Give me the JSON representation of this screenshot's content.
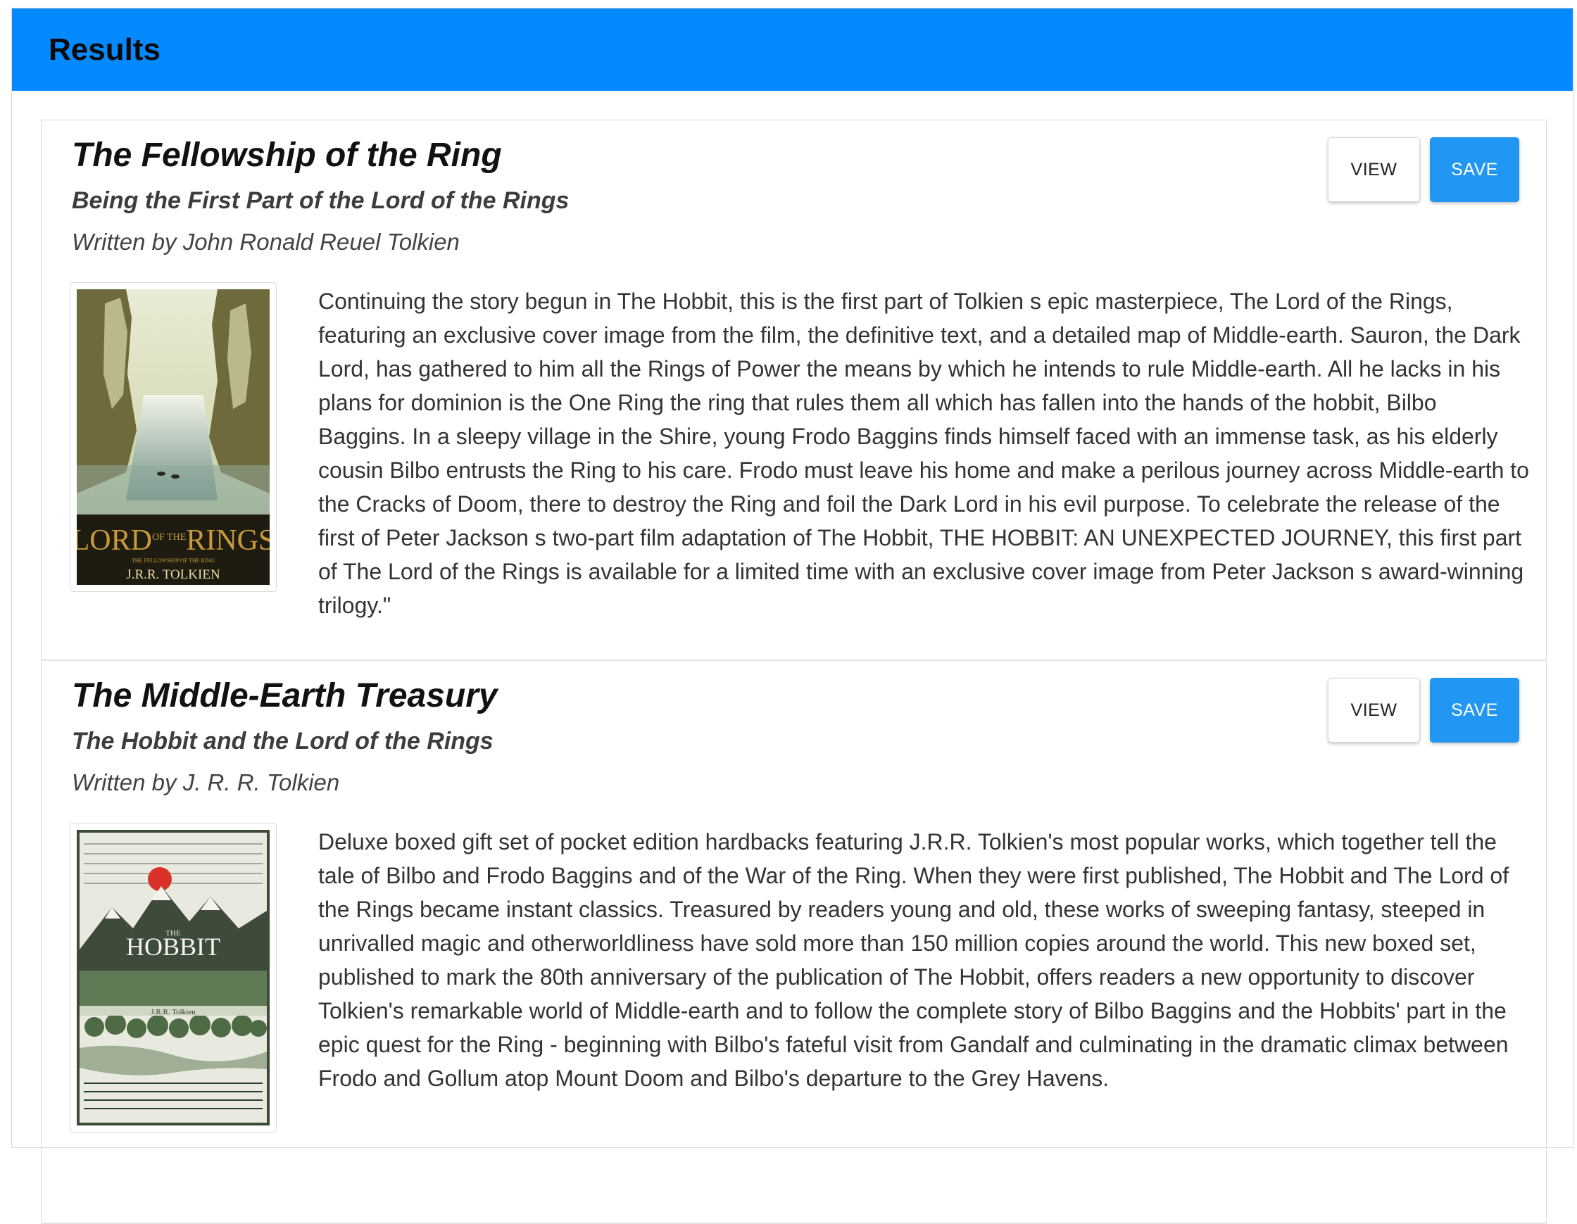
{
  "header": {
    "title": "Results"
  },
  "colors": {
    "header_bg": "#0589ff",
    "save_button": "#2196f3"
  },
  "results": [
    {
      "title": "The Fellowship of the Ring",
      "subtitle": "Being the First Part of the Lord of the Rings",
      "author": "Written by John Ronald Reuel Tolkien",
      "view_label": "VIEW",
      "save_label": "SAVE",
      "cover": {
        "line1": "LORD",
        "line1_small": "OF THE",
        "line1_end": "RINGS",
        "line2": "THE FELLOWSHIP OF THE RING",
        "line3": "J.R.R. TOLKIEN"
      },
      "description": "Continuing the story begun in The Hobbit, this is the first part of Tolkien s epic masterpiece, The Lord of the Rings, featuring an exclusive cover image from the film, the definitive text, and a detailed map of Middle-earth. Sauron, the Dark Lord, has gathered to him all the Rings of Power the means by which he intends to rule Middle-earth. All he lacks in his plans for dominion is the One Ring the ring that rules them all which has fallen into the hands of the hobbit, Bilbo Baggins. In a sleepy village in the Shire, young Frodo Baggins finds himself faced with an immense task, as his elderly cousin Bilbo entrusts the Ring to his care. Frodo must leave his home and make a perilous journey across Middle-earth to the Cracks of Doom, there to destroy the Ring and foil the Dark Lord in his evil purpose. To celebrate the release of the first of Peter Jackson s two-part film adaptation of The Hobbit, THE HOBBIT: AN UNEXPECTED JOURNEY, this first part of The Lord of the Rings is available for a limited time with an exclusive cover image from Peter Jackson s award-winning trilogy.\""
    },
    {
      "title": "The Middle-Earth Treasury",
      "subtitle": "The Hobbit and the Lord of the Rings",
      "author": "Written by J. R. R. Tolkien",
      "view_label": "VIEW",
      "save_label": "SAVE",
      "cover": {
        "line1": "THE",
        "line2": "HOBBIT",
        "line3": "J.R.R. Tolkien"
      },
      "description": "Deluxe boxed gift set of pocket edition hardbacks featuring J.R.R. Tolkien's most popular works, which together tell the tale of Bilbo and Frodo Baggins and of the War of the Ring. When they were first published, The Hobbit and The Lord of the Rings became instant classics. Treasured by readers young and old, these works of sweeping fantasy, steeped in unrivalled magic and otherworldliness have sold more than 150 million copies around the world. This new boxed set, published to mark the 80th anniversary of the publication of The Hobbit, offers readers a new opportunity to discover Tolkien's remarkable world of Middle-earth and to follow the complete story of Bilbo Baggins and the Hobbits' part in the epic quest for the Ring - beginning with Bilbo's fateful visit from Gandalf and culminating in the dramatic climax between Frodo and Gollum atop Mount Doom and Bilbo's departure to the Grey Havens."
    }
  ]
}
